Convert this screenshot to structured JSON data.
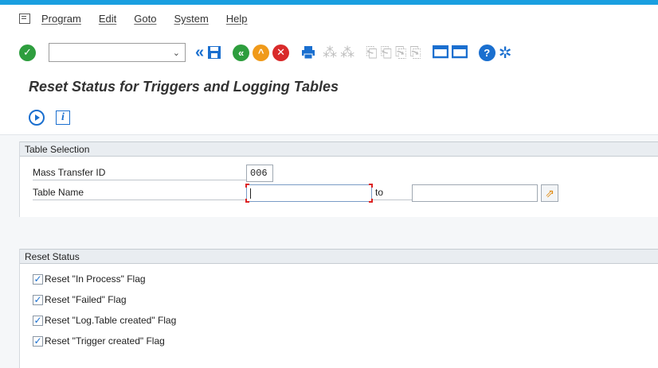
{
  "menubar": {
    "items": [
      "Program",
      "Edit",
      "Goto",
      "System",
      "Help"
    ]
  },
  "toolbar": {
    "command_field_value": "",
    "icons": [
      "enter-icon",
      "command-field",
      "back-icon",
      "save-icon",
      "back-green-icon",
      "exit-icon",
      "cancel-icon",
      "print-icon",
      "find-icon",
      "find-next-icon",
      "first-page-icon",
      "previous-page-icon",
      "next-page-icon",
      "last-page-icon",
      "create-session-icon",
      "generate-shortcut-icon",
      "help-icon",
      "customize-icon"
    ]
  },
  "title": "Reset Status for Triggers and Logging Tables",
  "app_toolbar": {
    "icons": [
      "execute-icon",
      "information-icon"
    ]
  },
  "table_selection": {
    "header": "Table Selection",
    "mass_transfer_label": "Mass Transfer ID",
    "mass_transfer_value": "006",
    "table_name_label": "Table Name",
    "table_name_from": "",
    "to_label": "to",
    "table_name_to": ""
  },
  "reset_status": {
    "header": "Reset Status",
    "flags": [
      {
        "label": "Reset \"In Process\" Flag",
        "checked": true
      },
      {
        "label": "Reset \"Failed\" Flag",
        "checked": true
      },
      {
        "label": "Reset \"Log.Table created\" Flag",
        "checked": true
      },
      {
        "label": "Reset \"Trigger created\" Flag",
        "checked": true
      }
    ]
  },
  "colors": {
    "accent": "#1a9fe0",
    "icon_blue": "#1a6fcf",
    "ok_green": "#2e9e3e",
    "exit_orange": "#f09a1a",
    "cancel_red": "#d92a2a"
  }
}
